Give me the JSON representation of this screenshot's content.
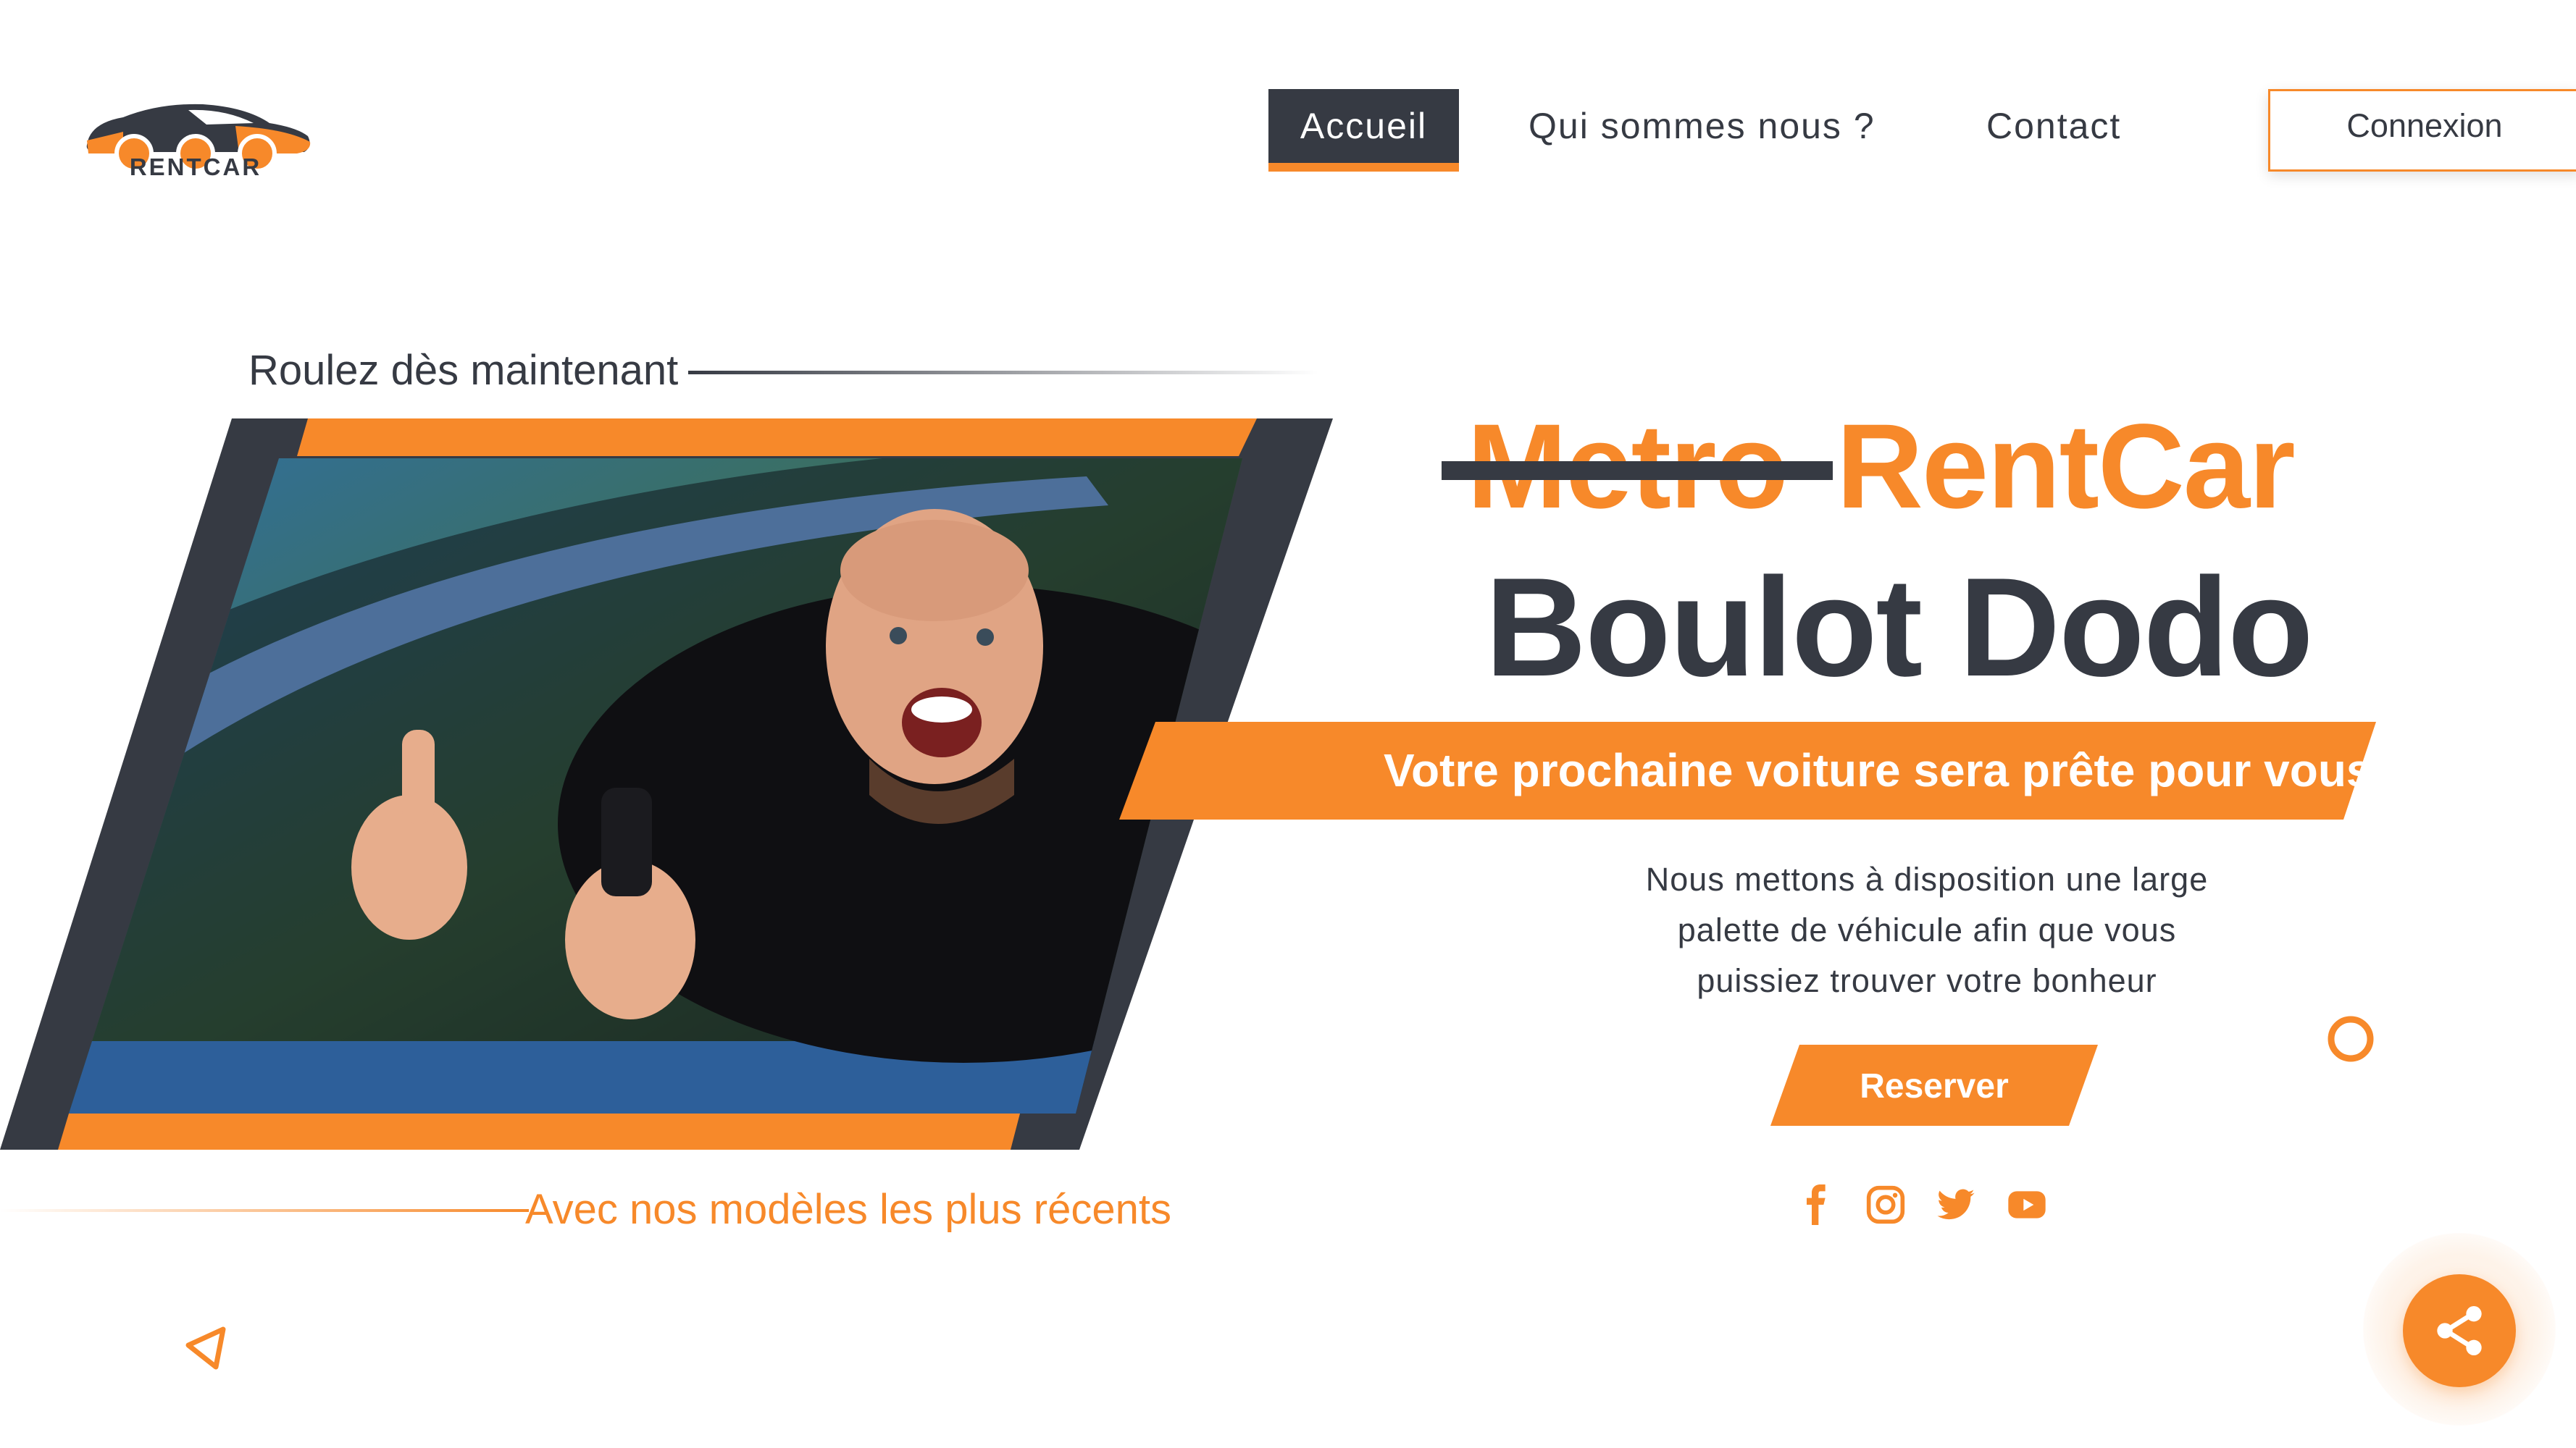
{
  "brand": {
    "logo_text": "RENTCAR"
  },
  "nav": {
    "items": [
      {
        "label": "Accueil",
        "active": true
      },
      {
        "label": "Qui sommes nous ?"
      },
      {
        "label": "Contact"
      }
    ],
    "login_label": "Connexion"
  },
  "hero": {
    "kicker": "Roulez dès maintenant",
    "sub_kicker": "Avec nos modèles les plus récents",
    "title_struck": "Metro",
    "title_brand": "RentCar",
    "title_main": "Boulot Dodo",
    "tagline": "Votre prochaine voiture sera prête pour vous",
    "description_lines": [
      "Nous mettons à disposition une large",
      "palette de véhicule afin que vous",
      "puissiez trouver votre bonheur"
    ],
    "reserve_label": "Reserver"
  },
  "social_icons": [
    "facebook-icon",
    "instagram-icon",
    "twitter-icon",
    "youtube-icon"
  ],
  "colors": {
    "accent": "#f7892a",
    "dark": "#363a43",
    "background": "#ffffff"
  }
}
